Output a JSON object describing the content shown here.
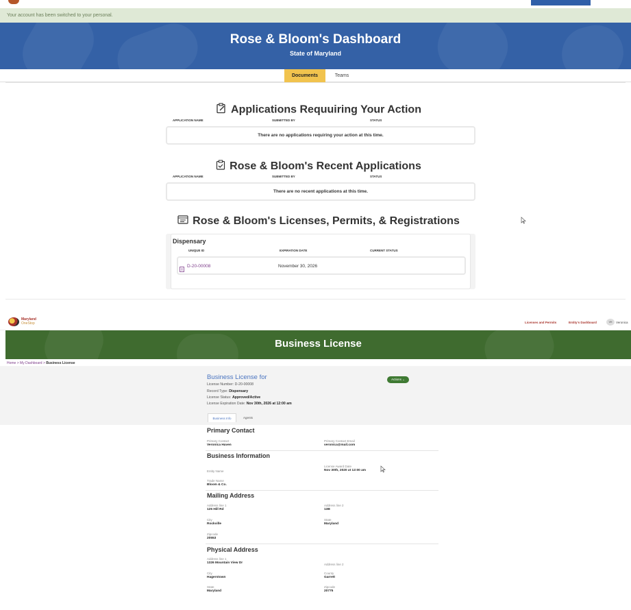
{
  "top": {
    "flash_message": "Your account has been switched to your personal.",
    "hero_title": "Rose & Bloom's Dashboard",
    "hero_subtitle": "State of Maryland",
    "tabs": [
      "Documents",
      "Teams"
    ],
    "section1": {
      "title": "Applications Requuiring Your Action",
      "columns": [
        "APPLICATION NAME",
        "SUBMITTED BY",
        "STATUS"
      ],
      "empty_text": "There are no applications requiring your action at this time."
    },
    "section2": {
      "title": "Rose & Bloom's Recent Applications",
      "columns": [
        "APPLICATION NAME",
        "SUBMITTED BY",
        "STATUS"
      ],
      "empty_text": "There are no recent applications at this time."
    },
    "section3": {
      "title": "Rose & Bloom's Licenses, Permits, & Registrations",
      "license_type": "Dispensary",
      "columns": [
        "UNIQUE ID",
        "EXPIRATION DATE",
        "CURRENT STATUS"
      ],
      "row": {
        "id": "D-20-00008",
        "expiration": "November 30, 2026",
        "status": ""
      }
    }
  },
  "bottom": {
    "logo_line1": "Maryland",
    "logo_line2": "OneStop",
    "nav_links": [
      "Licenses and Permits",
      "Entity's Dashboard"
    ],
    "avatar_initials": "VH",
    "user_name": "Veronica",
    "hero_title": "Business License",
    "breadcrumb": {
      "home": "Home",
      "dashboard": "My Dashboard",
      "current": "Business License",
      "sep": ">"
    },
    "summary": {
      "title": "Business License for",
      "license_number_label": "License Number: D-20-00008",
      "record_type_label": "Record Type:",
      "record_type": "Dispensary",
      "status_label": "License Status:",
      "status": "Approved/Active",
      "expiration_label": "License Expiration Date:",
      "expiration": "Nov 30th, 2026 at 12:00 am",
      "actions_label": "Actions ⌄",
      "tabs": [
        "Business Info",
        "Agents"
      ]
    },
    "primary_contact": {
      "heading": "Primary Contact",
      "contact_label": "Primary Contact",
      "contact_value": "Veronica Haven",
      "email_label": "Primary Contact Email",
      "email_value": "veronica@mail.com"
    },
    "business_info": {
      "heading": "Business Information",
      "entity_label": "Entity Name",
      "entity_value": "",
      "award_label": "License Award Date",
      "award_value": "Nov 30th, 2020 at 12:00 am",
      "trade_label": "Trade Name",
      "trade_value": "Bloom & Co."
    },
    "mailing": {
      "heading": "Mailing Address",
      "line1_label": "Address line 1",
      "line1_value": "125 Hill Rd",
      "line2_label": "Address line 2",
      "line2_value": "13B",
      "city_label": "City",
      "city_value": "Rockville",
      "state_label": "State",
      "state_value": "Maryland",
      "zip_label": "Zipcode",
      "zip_value": "20553"
    },
    "physical": {
      "heading": "Physical Address",
      "line1_label": "Address line 1",
      "line1_value": "1326 Mountain View Dr",
      "line2_label": "Address line 2",
      "line2_value": "",
      "city_label": "City",
      "city_value": "Hagerstown",
      "county_label": "County",
      "county_value": "Garrett",
      "state_label": "State",
      "state_value": "Maryland",
      "zip_label": "Zipcode",
      "zip_value": "20775"
    }
  },
  "colors": {
    "hero_blue": "#3461a6",
    "hero_green": "#3f6b2f",
    "tab_active": "#f1c34e",
    "link_purple": "#7d3c8a"
  }
}
